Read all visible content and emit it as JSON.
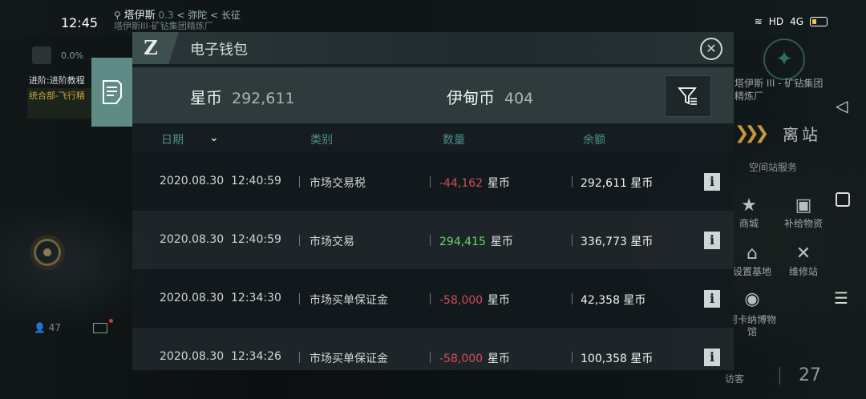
{
  "status_bar": {
    "time": "12:45",
    "location_region": "塔伊斯",
    "location_security": "0.3",
    "location_constellation": "弥陀",
    "location_system": "长征",
    "location_station": "塔伊斯III-矿钻集团精炼厂",
    "network": "HD",
    "signal": "4G"
  },
  "left_hud": {
    "cargo_pct": "0.0%",
    "quest_label": "进阶:进阶教程",
    "quest_sub": "统合部-飞行精",
    "online_count": "47"
  },
  "right_hud": {
    "station_name": "塔伊斯 III - 矿钻集团 精炼厂",
    "undock_label": "离站",
    "services_title": "空间站服务",
    "services": [
      {
        "label": "商城"
      },
      {
        "label": "补给物资"
      },
      {
        "label": "设置基地"
      },
      {
        "label": "维修站"
      },
      {
        "label": "阿卡纳博物馆"
      }
    ],
    "visitor_label": "访客",
    "visitor_count": "27"
  },
  "wallet": {
    "title": "电子钱包",
    "logo": "Z",
    "balances": {
      "star_coin_label": "星币",
      "star_coin_value": "292,611",
      "ydn_label": "伊甸币",
      "ydn_value": "404"
    },
    "columns": {
      "date": "日期",
      "category": "类别",
      "amount": "数量",
      "balance": "余额"
    },
    "rows": [
      {
        "date": "2020.08.30",
        "time": "12:40:59",
        "category": "市场交易税",
        "amount": "-44,162",
        "amount_unit": "星币",
        "balance": "292,611 星币",
        "sign": "neg"
      },
      {
        "date": "2020.08.30",
        "time": "12:40:59",
        "category": "市场交易",
        "amount": "294,415",
        "amount_unit": "星币",
        "balance": "336,773 星币",
        "sign": "pos"
      },
      {
        "date": "2020.08.30",
        "time": "12:34:30",
        "category": "市场买单保证金",
        "amount": "-58,000",
        "amount_unit": "星币",
        "balance": "42,358 星币",
        "sign": "neg"
      },
      {
        "date": "2020.08.30",
        "time": "12:34:26",
        "category": "市场买单保证金",
        "amount": "-58,000",
        "amount_unit": "星币",
        "balance": "100,358 星币",
        "sign": "neg"
      }
    ]
  },
  "colors": {
    "accent": "#5f8a85",
    "negative": "#d64a5a",
    "positive": "#6ecf6e",
    "column_header": "#4f8e8e"
  }
}
